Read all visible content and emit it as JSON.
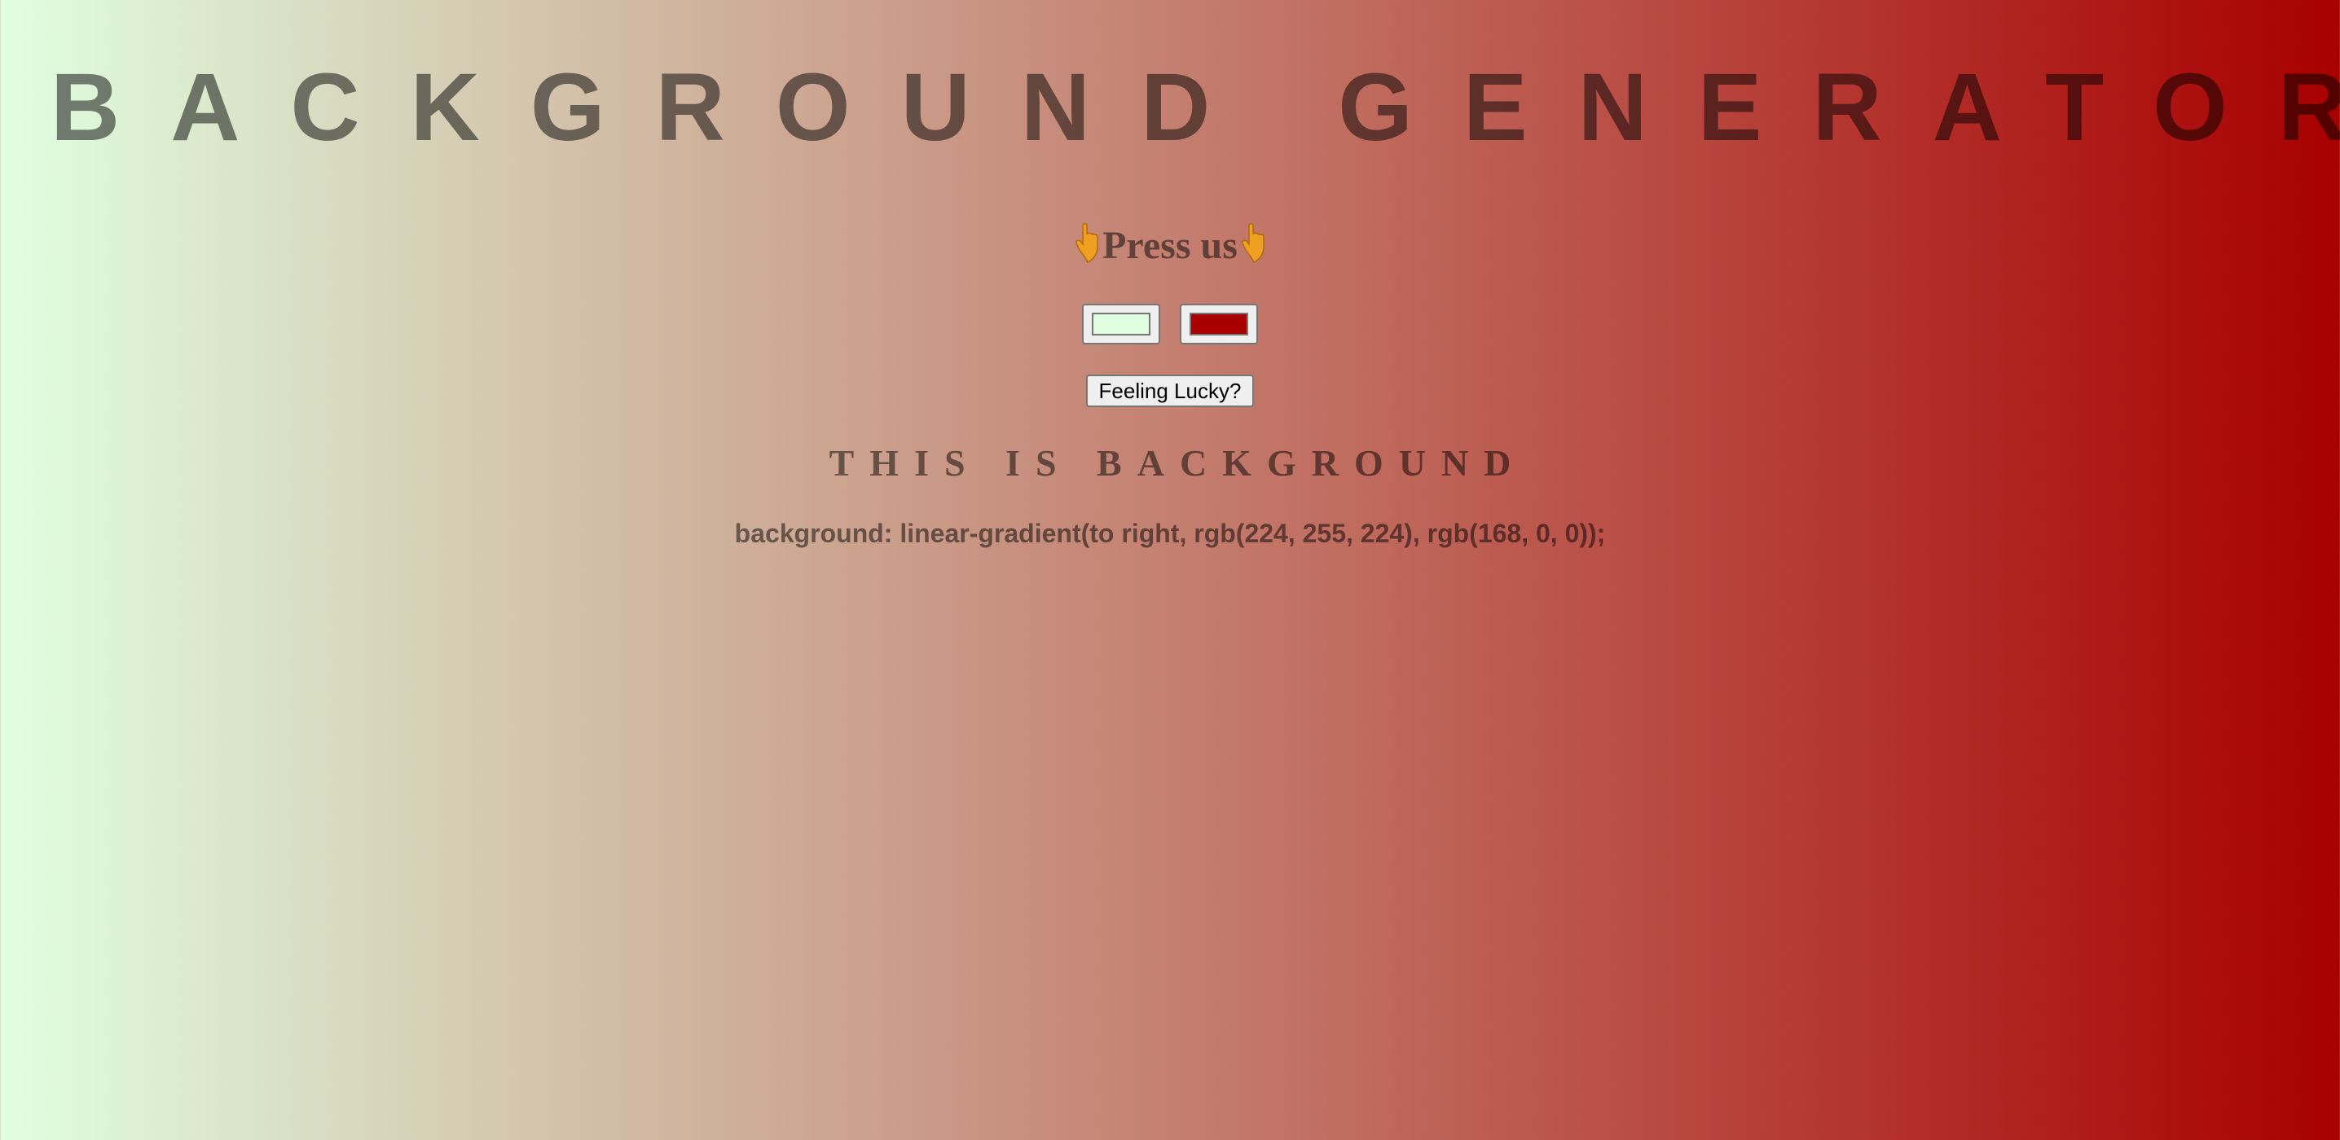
{
  "header": {
    "title": "BACKGROUND GENERATOR"
  },
  "prompt": {
    "text": "Press us",
    "icon": "hand-pointing-down-icon"
  },
  "color_inputs": {
    "color1": "#e0ffe0",
    "color2": "#a80000"
  },
  "lucky_button": {
    "label": "Feeling Lucky?"
  },
  "subtitle": {
    "text": "THIS IS BACKGROUND"
  },
  "css_output": {
    "text": "background: linear-gradient(to right, rgb(224, 255, 224), rgb(168, 0, 0));"
  }
}
